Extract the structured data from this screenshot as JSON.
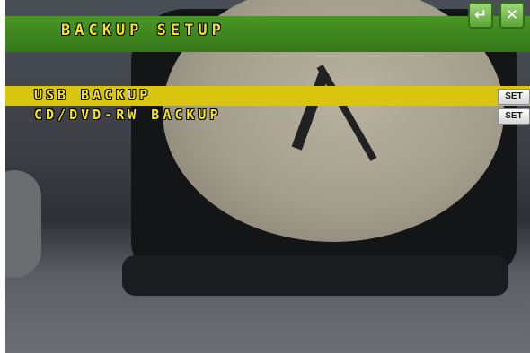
{
  "window": {
    "title": "BACKUP SETUP",
    "back_icon": "return-arrow-icon",
    "back_glyph": "↵",
    "close_icon": "close-icon",
    "close_glyph": "✕"
  },
  "menu": {
    "items": [
      {
        "label": "USB BACKUP",
        "set_label": "SET",
        "selected": true
      },
      {
        "label": "CD/DVD-RW BACKUP",
        "set_label": "SET",
        "selected": false
      }
    ]
  },
  "colors": {
    "titlebar": "#3a7f1d",
    "title_text": "#f3e11b",
    "selection": "#d9c410"
  }
}
